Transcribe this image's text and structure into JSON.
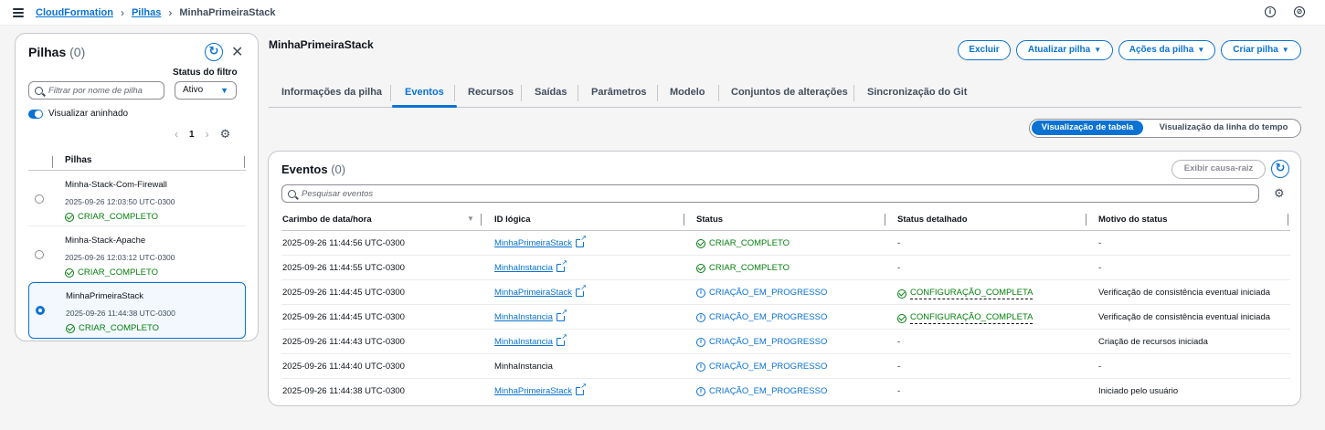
{
  "breadcrumb": {
    "items": [
      "CloudFormation",
      "Pilhas"
    ],
    "current": "MinhaPrimeiraStack"
  },
  "top_icons": [
    "info-icon",
    "settings-icon"
  ],
  "left_panel": {
    "title": "Pilhas",
    "count": "(0)",
    "filter_label": "Status do filtro",
    "search_placeholder": "Filtrar por nome de pilha",
    "filter_value": "Ativo",
    "toggle_label": "Visualizar aninhado",
    "page": "1",
    "column_header": "Pilhas",
    "stacks": [
      {
        "name": "Minha-Stack-Com-Firewall",
        "date": "2025-09-26 12:03:50 UTC-0300",
        "status": "CRIAR_COMPLETO",
        "selected": false
      },
      {
        "name": "Minha-Stack-Apache",
        "date": "2025-09-26 12:03:12 UTC-0300",
        "status": "CRIAR_COMPLETO",
        "selected": false
      },
      {
        "name": "MinhaPrimeiraStack",
        "date": "2025-09-26 11:44:38 UTC-0300",
        "status": "CRIAR_COMPLETO",
        "selected": true
      }
    ]
  },
  "main": {
    "title": "MinhaPrimeiraStack",
    "buttons": {
      "delete": "Excluir",
      "update": "Atualizar pilha",
      "actions": "Ações da pilha",
      "create": "Criar pilha"
    },
    "tabs": [
      {
        "label": "Informações da pilha"
      },
      {
        "label": "Eventos"
      },
      {
        "label": "Recursos"
      },
      {
        "label": "Saídas"
      },
      {
        "label": "Parâmetros"
      },
      {
        "label": "Modelo"
      },
      {
        "label": "Conjuntos de alterações"
      },
      {
        "label": "Sincronização do Git"
      }
    ],
    "active_tab": "Eventos",
    "view_toggle": {
      "table": "Visualização de tabela",
      "timeline": "Visualização da linha do tempo"
    }
  },
  "events": {
    "title": "Eventos",
    "count": "(0)",
    "root_cause_button": "Exibir causa-raiz",
    "search_placeholder": "Pesquisar eventos",
    "columns": [
      "Carimbo de data/hora",
      "ID lógica",
      "Status",
      "Status detalhado",
      "Motivo do status"
    ],
    "rows": [
      {
        "time": "2025-09-26 11:44:56 UTC-0300",
        "id": "MinhaPrimeiraStack",
        "id_link": true,
        "status": "CRIAR_COMPLETO",
        "status_kind": "ok",
        "detail": "-",
        "detail_kind": "none",
        "reason": "-"
      },
      {
        "time": "2025-09-26 11:44:55 UTC-0300",
        "id": "MinhaInstancia",
        "id_link": true,
        "status": "CRIAR_COMPLETO",
        "status_kind": "ok",
        "detail": "-",
        "detail_kind": "none",
        "reason": "-"
      },
      {
        "time": "2025-09-26 11:44:45 UTC-0300",
        "id": "MinhaPrimeiraStack",
        "id_link": true,
        "status": "CRIAÇÃO_EM_PROGRESSO",
        "status_kind": "info",
        "detail": "CONFIGURAÇÃO_COMPLETA",
        "detail_kind": "ok",
        "reason": "Verificação de consistência eventual iniciada"
      },
      {
        "time": "2025-09-26 11:44:45 UTC-0300",
        "id": "MinhaInstancia",
        "id_link": true,
        "status": "CRIAÇÃO_EM_PROGRESSO",
        "status_kind": "info",
        "detail": "CONFIGURAÇÃO_COMPLETA",
        "detail_kind": "ok",
        "reason": "Verificação de consistência eventual iniciada"
      },
      {
        "time": "2025-09-26 11:44:43 UTC-0300",
        "id": "MinhaInstancia",
        "id_link": true,
        "status": "CRIAÇÃO_EM_PROGRESSO",
        "status_kind": "info",
        "detail": "-",
        "detail_kind": "none",
        "reason": "Criação de recursos iniciada"
      },
      {
        "time": "2025-09-26 11:44:40 UTC-0300",
        "id": "MinhaInstancia",
        "id_link": false,
        "status": "CRIAÇÃO_EM_PROGRESSO",
        "status_kind": "info",
        "detail": "-",
        "detail_kind": "none",
        "reason": "-"
      },
      {
        "time": "2025-09-26 11:44:38 UTC-0300",
        "id": "MinhaPrimeiraStack",
        "id_link": true,
        "status": "CRIAÇÃO_EM_PROGRESSO",
        "status_kind": "info",
        "detail": "-",
        "detail_kind": "none",
        "reason": "Iniciado pelo usuário"
      }
    ]
  },
  "colors": {
    "accent": "#0972d3",
    "success": "#037f0c",
    "text": "#0f141a",
    "border": "#c6c6cd"
  }
}
